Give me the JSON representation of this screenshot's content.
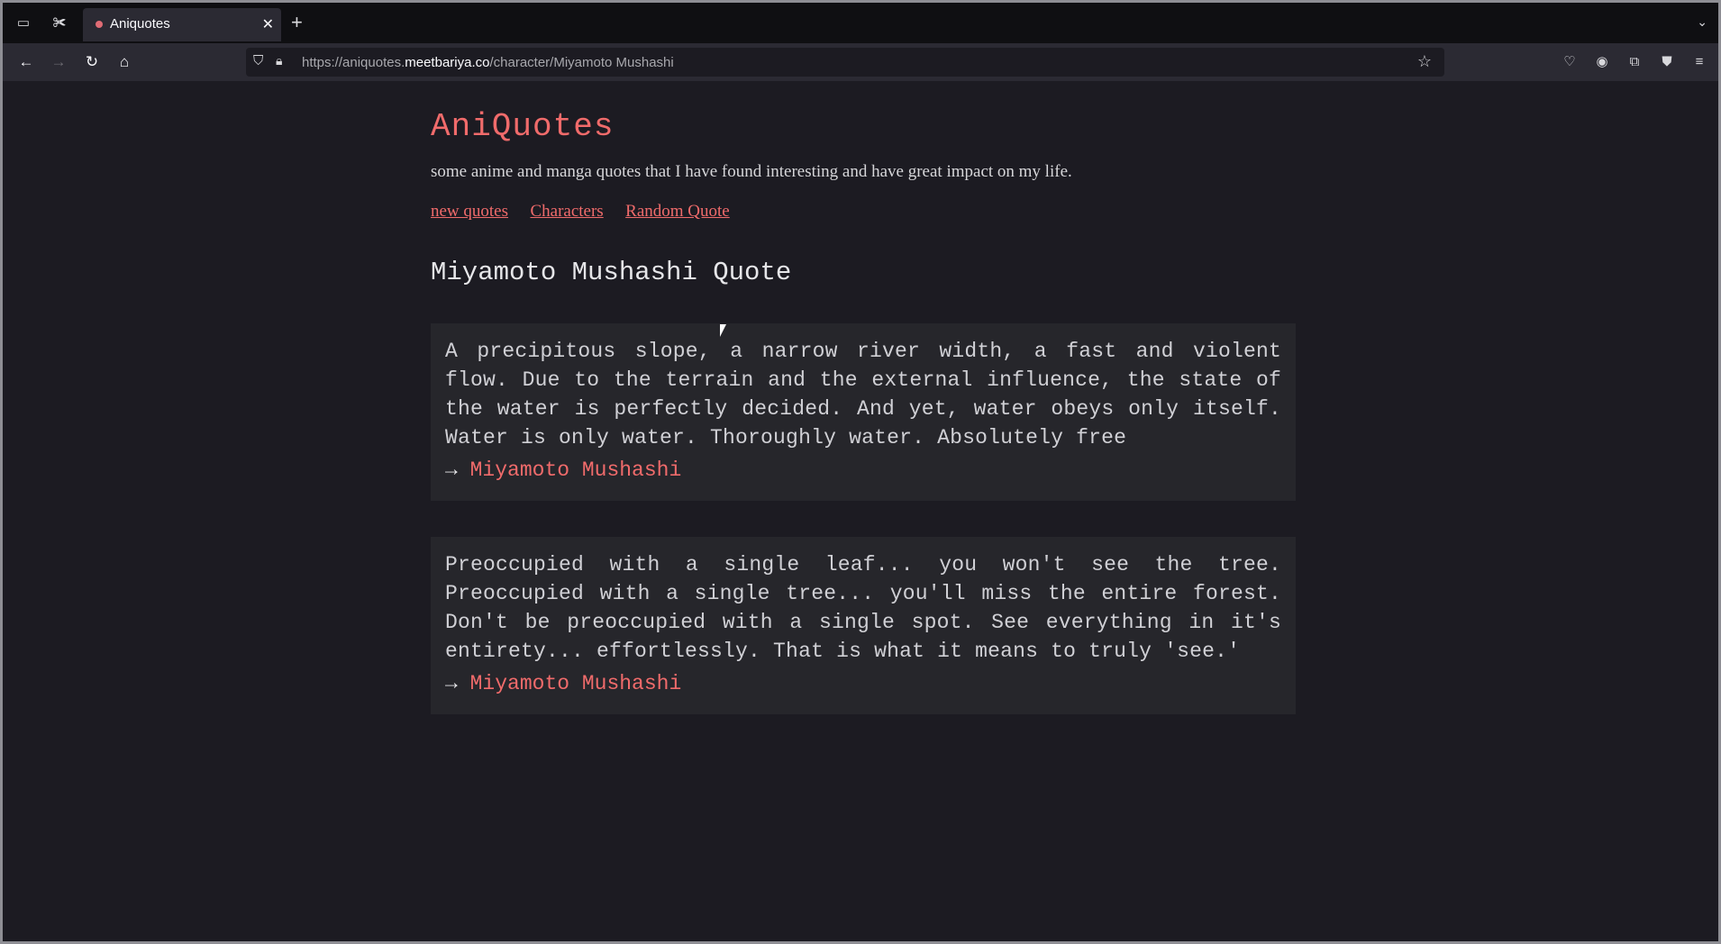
{
  "browser": {
    "tab_title": "Aniquotes",
    "tab_close": "✕",
    "new_tab": "+",
    "url_prefix": "https://aniquotes.",
    "url_domain": "meetbariya.co",
    "url_path": "/character/Miyamoto Mushashi"
  },
  "site": {
    "title": "AniQuotes",
    "subtitle": "some anime and manga quotes that I have found interesting and have great impact on my life.",
    "nav": [
      "new quotes",
      "Characters",
      "Random Quote"
    ]
  },
  "page": {
    "heading": "Miyamoto Mushashi Quote",
    "arrow": "→",
    "quotes": [
      {
        "text": "A precipitous slope, a narrow river width, a fast and violent flow. Due to the terrain and the external influence, the state of the water is perfectly decided. And yet, water obeys only itself. Water is only water. Thoroughly water. Absolutely free",
        "author": "Miyamoto Mushashi"
      },
      {
        "text": "Preoccupied with a single leaf... you won't see the tree. Preoccupied with a single tree... you'll miss the entire forest. Don't be preoccupied with a single spot. See everything in it's entirety... effortlessly. That is what it means to truly 'see.'",
        "author": "Miyamoto Mushashi"
      }
    ]
  },
  "colors": {
    "accent": "#f06b6b",
    "background": "#1c1b22",
    "card": "#26262b"
  }
}
